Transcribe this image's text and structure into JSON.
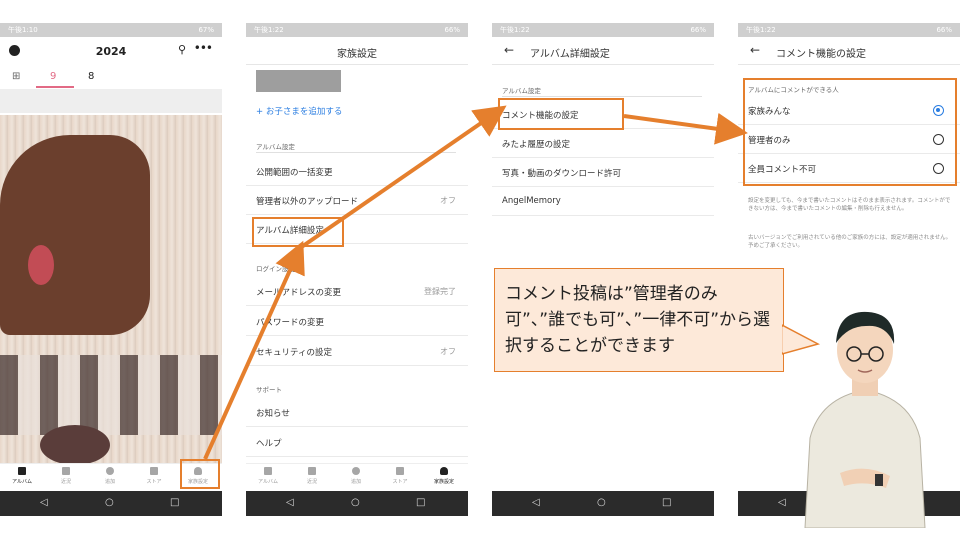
{
  "screen1": {
    "status_time": "午後1:10",
    "status_battery": "67%",
    "title": "2024",
    "tab_count_a": "9",
    "tab_count_b": "8",
    "nav": [
      "アルバム",
      "近況",
      "追加",
      "ストア",
      "家族設定"
    ]
  },
  "screen2": {
    "status_time": "午後1:22",
    "status_battery": "66%",
    "title": "家族設定",
    "add_child": "+ お子さまを追加する",
    "album_section": "アルバム設定",
    "items": [
      {
        "label": "公開範囲の一括変更",
        "value": ""
      },
      {
        "label": "管理者以外のアップロード",
        "value": "オフ"
      },
      {
        "label": "アルバム詳細設定",
        "value": ""
      }
    ],
    "login_section": "ログイン設定",
    "login_items": [
      {
        "label": "メールアドレスの変更",
        "value": "登録完了"
      },
      {
        "label": "パスワードの変更",
        "value": ""
      },
      {
        "label": "セキュリティの設定",
        "value": "オフ"
      }
    ],
    "support_section": "サポート",
    "support_items": [
      "お知らせ",
      "ヘルプ"
    ],
    "nav": [
      "アルバム",
      "近況",
      "追加",
      "ストア",
      "家族設定"
    ]
  },
  "screen3": {
    "status_time": "午後1:22",
    "status_battery": "66%",
    "title": "アルバム詳細設定",
    "section": "アルバム設定",
    "items": [
      "コメント機能の設定",
      "みたよ履歴の設定",
      "写真・動画のダウンロード許可",
      "AngelMemory"
    ]
  },
  "screen4": {
    "status_time": "午後1:22",
    "status_battery": "66%",
    "title": "コメント機能の設定",
    "section": "アルバムにコメントができる人",
    "options": [
      "家族みんな",
      "管理者のみ",
      "全員コメント不可"
    ],
    "selected_option": "家族みんな",
    "note1": "設定を変更しても、今まで書いたコメントはそのまま表示されます。コメントができない方は、今まで書いたコメントの編集・削除も行えません。",
    "note2": "古いバージョンでご利用されている他のご家族の方には、設定が適用されません。予めご了承ください。"
  },
  "callout": {
    "text": "コメント投稿は”管理者のみ可”、”誰でも可”、”一律不可”から選択することができます"
  },
  "colors": {
    "accent": "#e57f2d",
    "callout_bg": "#fde9d9",
    "pink_tab": "#e26a85",
    "link": "#2a7de1",
    "system_nav": "#2b2b2b"
  },
  "icons": [
    "back-arrow-icon",
    "search-icon",
    "more-icon",
    "grid-icon",
    "home-icon",
    "news-icon",
    "add-icon",
    "store-icon",
    "person-icon",
    "radio-icon",
    "sysnav-back-icon",
    "sysnav-home-icon",
    "sysnav-recent-icon",
    "arrow-icon"
  ]
}
